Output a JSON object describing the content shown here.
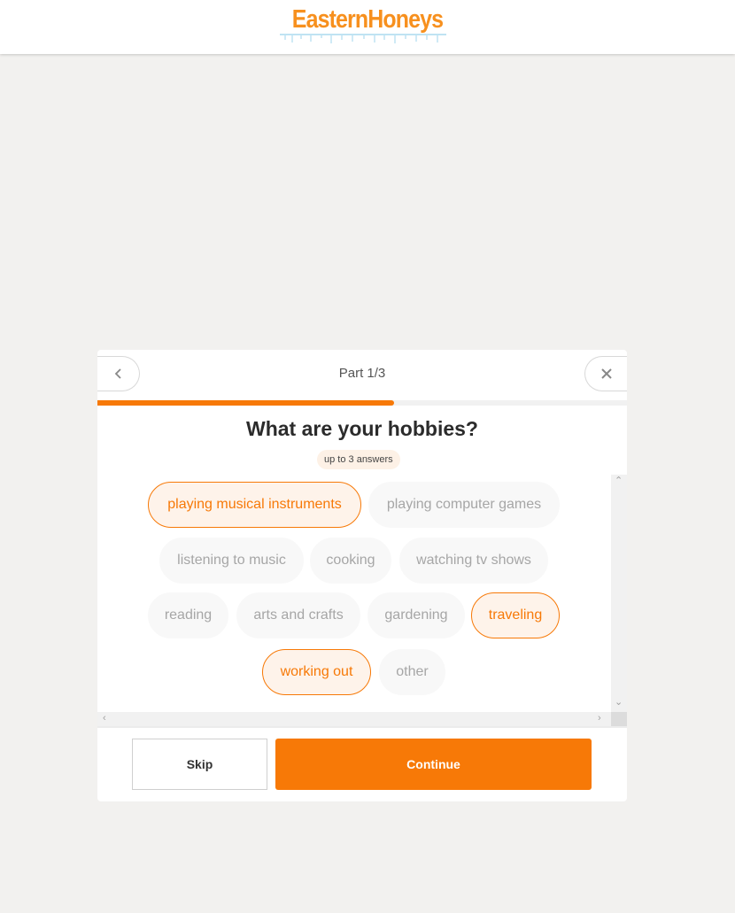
{
  "header": {
    "logo_text": "EasternHoneys"
  },
  "modal": {
    "part_label": "Part 1/3",
    "progress": 0.56,
    "question": "What are your hobbies?",
    "hint": "up to 3 answers",
    "options": [
      {
        "label": "playing musical instruments",
        "selected": true
      },
      {
        "label": "playing computer games",
        "selected": false
      },
      {
        "label": "listening to music",
        "selected": false
      },
      {
        "label": "cooking",
        "selected": false
      },
      {
        "label": "watching tv shows",
        "selected": false
      },
      {
        "label": "reading",
        "selected": false
      },
      {
        "label": "arts and crafts",
        "selected": false
      },
      {
        "label": "gardening",
        "selected": false
      },
      {
        "label": "traveling",
        "selected": true
      },
      {
        "label": "working out",
        "selected": true
      },
      {
        "label": "other",
        "selected": false
      }
    ],
    "skip_label": "Skip",
    "continue_label": "Continue"
  },
  "icons": {
    "back": "chevron-left-icon",
    "close": "close-icon"
  },
  "colors": {
    "accent": "#f77907",
    "logo": "#f7901e",
    "page_bg": "#f2f1ef"
  }
}
